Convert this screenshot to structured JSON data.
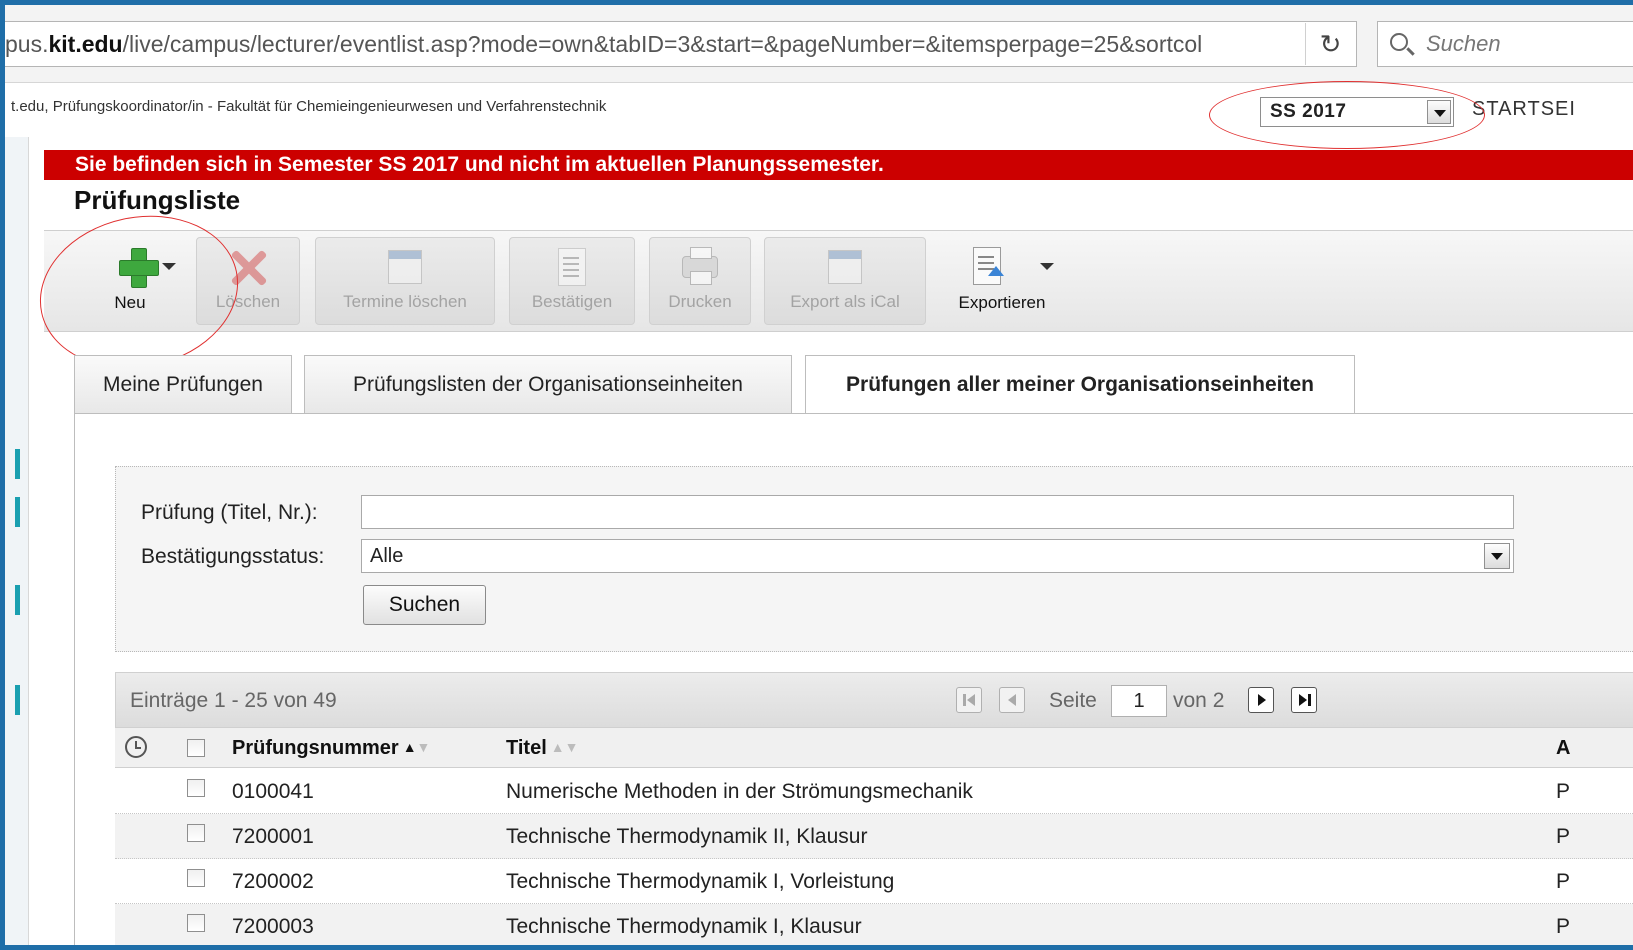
{
  "browser": {
    "url_prefix": "pus.",
    "url_domain": "kit.edu",
    "url_path": "/live/campus/lecturer/eventlist.asp?mode=own&tabID=3&start=&pageNumber=&itemsperpage=25&sortcol",
    "search_placeholder": "Suchen"
  },
  "header": {
    "info": "t.edu, Prüfungskoordinator/in - Fakultät für Chemieingenieurwesen und Verfahrenstechnik",
    "semester": "SS 2017",
    "startseite": "STARTSEI"
  },
  "banner": "Sie befinden sich in Semester SS 2017 und nicht im aktuellen Planungssemester.",
  "page_title": "Prüfungsliste",
  "toolbar": {
    "new": "Neu",
    "delete": "Löschen",
    "delete_dates": "Termine löschen",
    "confirm": "Bestätigen",
    "print": "Drucken",
    "export_ical": "Export als iCal",
    "export": "Exportieren"
  },
  "tabs": [
    {
      "label": "Meine Prüfungen"
    },
    {
      "label": "Prüfungslisten der Organisationseinheiten"
    },
    {
      "label": "Prüfungen aller meiner Organisationseinheiten"
    }
  ],
  "filter": {
    "exam_label": "Prüfung (Titel, Nr.):",
    "exam_value": "",
    "status_label": "Bestätigungsstatus:",
    "status_value": "Alle",
    "search_button": "Suchen"
  },
  "pager": {
    "entries": "Einträge 1 - 25 von 49",
    "page_label": "Seite",
    "page_value": "1",
    "of_label": "von 2"
  },
  "columns": {
    "number": "Prüfungsnummer",
    "title": "Titel",
    "a": "A"
  },
  "rows": [
    {
      "number": "0100041",
      "title": "Numerische Methoden in der Strömungsmechanik",
      "a": "P"
    },
    {
      "number": "7200001",
      "title": "Technische Thermodynamik II, Klausur",
      "a": "P"
    },
    {
      "number": "7200002",
      "title": "Technische Thermodynamik I, Vorleistung",
      "a": "P"
    },
    {
      "number": "7200003",
      "title": "Technische Thermodynamik I, Klausur",
      "a": "P"
    }
  ]
}
